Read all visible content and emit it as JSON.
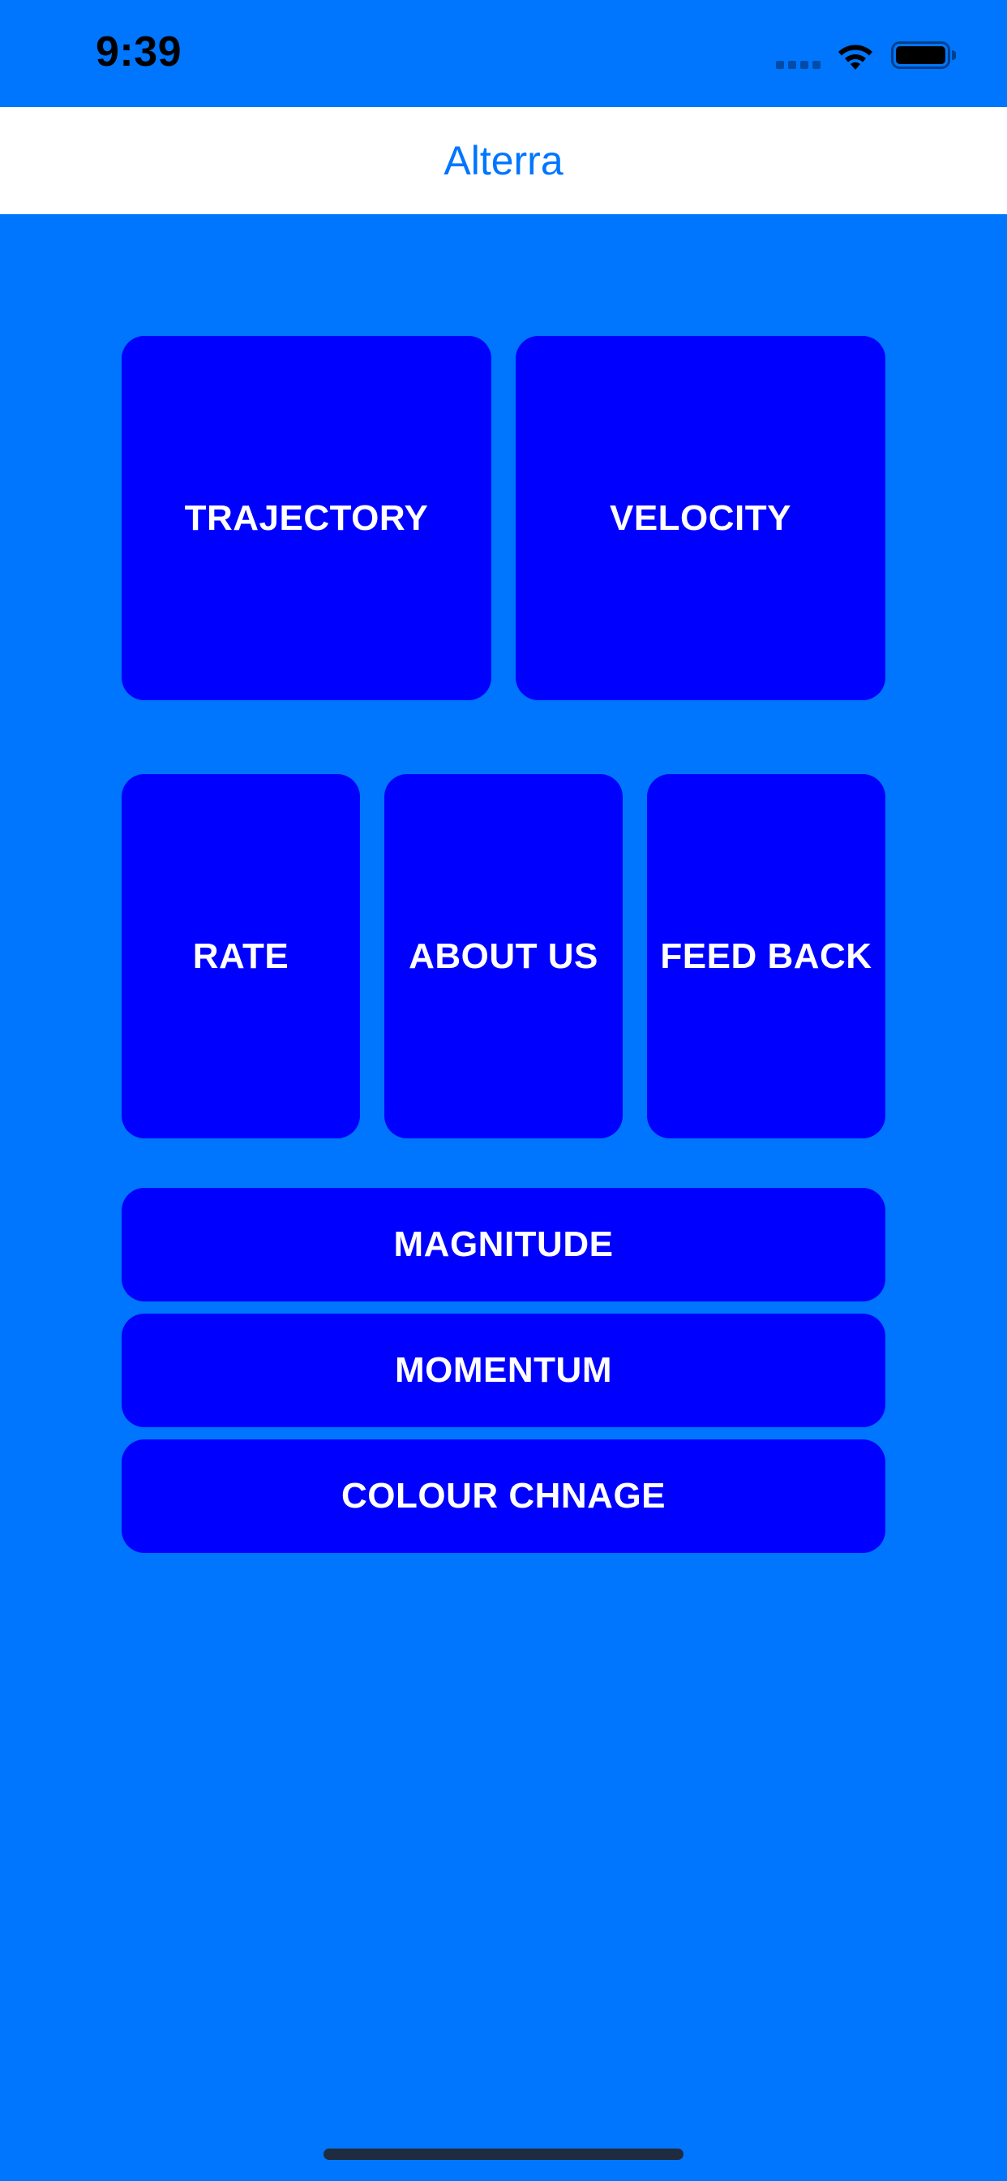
{
  "status_bar": {
    "time": "9:39",
    "signal_icon": "cellular-signal-icon",
    "wifi_icon": "wifi-icon",
    "battery_icon": "battery-icon"
  },
  "nav": {
    "title": "Alterra"
  },
  "tiles": {
    "trajectory": "TRAJECTORY",
    "velocity": "VELOCITY",
    "rate": "RATE",
    "about_us": "ABOUT US",
    "feed_back": "FEED BACK",
    "magnitude": "MAGNITUDE",
    "momentum": "MOMENTUM",
    "colour_change": "COLOUR CHNAGE"
  },
  "colors": {
    "background": "#0076FF",
    "tile": "#0000FF",
    "nav_bar": "#FFFFFF",
    "nav_title": "#0076FF",
    "tile_text": "#FFFFFF"
  }
}
